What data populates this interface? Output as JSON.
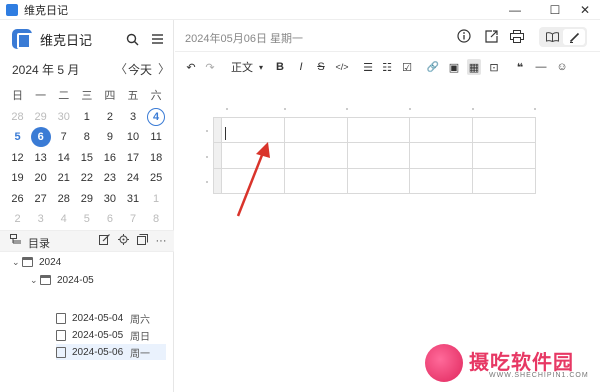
{
  "window": {
    "title": "维克日记",
    "minimize": "—",
    "maximize": "☐",
    "close": "✕"
  },
  "sidebar": {
    "app_name": "维克日记",
    "search_icon": "search-icon",
    "menu_icon": "menu-icon",
    "calendar": {
      "year_month": "2024 年 5 月",
      "prev": "〈",
      "next": "〉",
      "today_label": "今天",
      "weekdays": [
        "日",
        "一",
        "二",
        "三",
        "四",
        "五",
        "六"
      ],
      "rows": [
        [
          "28",
          "29",
          "30",
          "1",
          "2",
          "3",
          "4"
        ],
        [
          "5",
          "6",
          "7",
          "8",
          "9",
          "10",
          "11"
        ],
        [
          "12",
          "13",
          "14",
          "15",
          "16",
          "17",
          "18"
        ],
        [
          "19",
          "20",
          "21",
          "22",
          "23",
          "24",
          "25"
        ],
        [
          "26",
          "27",
          "28",
          "29",
          "30",
          "31",
          "1"
        ],
        [
          "2",
          "3",
          "4",
          "5",
          "6",
          "7",
          "8"
        ]
      ]
    },
    "directory": {
      "label": "目录",
      "year": "2024",
      "month": "2024-05",
      "entries": [
        {
          "date": "2024-05-04",
          "weekday": "周六"
        },
        {
          "date": "2024-05-05",
          "weekday": "周日"
        },
        {
          "date": "2024-05-06",
          "weekday": "周一"
        }
      ]
    }
  },
  "header": {
    "date": "2024年05月06日 星期一"
  },
  "toolbar": {
    "undo": "↶",
    "redo": "↷",
    "style": "正文",
    "style_caret": "▾",
    "bold": "B",
    "italic": "I",
    "strike": "S",
    "code": "</>",
    "bullet": "☰",
    "ordered": "☷",
    "task": "☑",
    "link": "🔗",
    "image": "▣",
    "table": "▦",
    "codeblock": "⊡",
    "quote": "❝",
    "hr": "—",
    "emoji": "☺"
  },
  "watermark": {
    "text": "摄吃软件园",
    "url": "WWW.SHECHIPIN1.COM"
  }
}
